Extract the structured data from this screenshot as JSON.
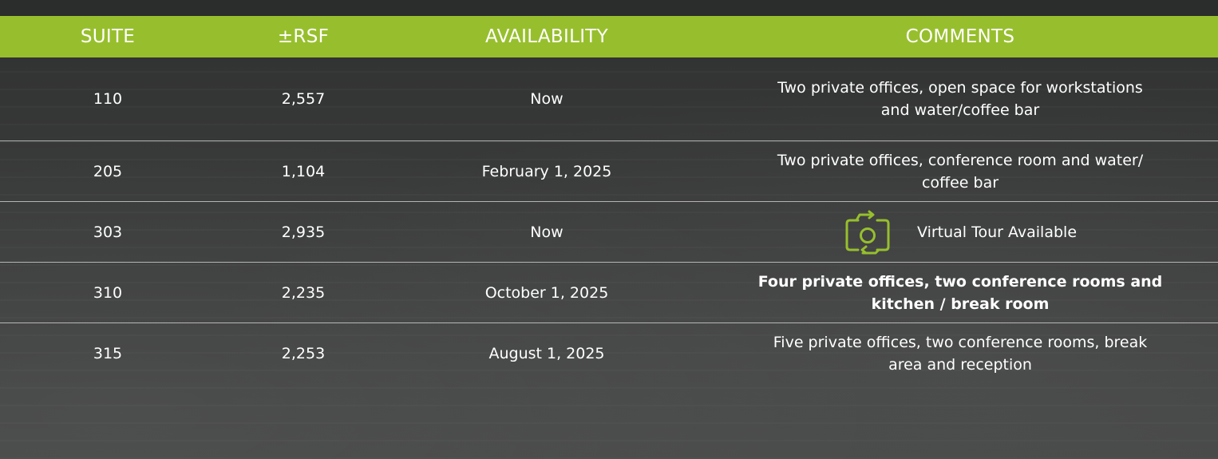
{
  "header": {
    "suite": "SUITE",
    "rsf": "±RSF",
    "availability": "AVAILABILITY",
    "comments": "COMMENTS"
  },
  "rows": [
    {
      "suite": "110",
      "rsf": "2,557",
      "availability": "Now",
      "comments": [
        "Two private offices, open space for workstations",
        "and water/coffee bar"
      ]
    },
    {
      "suite": "205",
      "rsf": "1,104",
      "availability": "February 1, 2025",
      "comments": [
        "Two private offices, conference room and water/",
        "coffee bar"
      ]
    },
    {
      "suite": "303",
      "rsf": "2,935",
      "availability": "Now",
      "comments": [
        "Virtual Tour Available"
      ],
      "icon": "virtual-tour-camera-icon"
    },
    {
      "suite": "310",
      "rsf": "2,235",
      "availability": "October 1, 2025",
      "comments": [
        "Four private offices, two conference rooms and",
        "kitchen / break room"
      ],
      "bold": true
    },
    {
      "suite": "315",
      "rsf": "2,253",
      "availability": "August 1, 2025",
      "comments": [
        "Five private offices, two conference rooms, break",
        "area and reception"
      ]
    }
  ],
  "colors": {
    "accent": "#97bf2d",
    "background": "#3a3b3b",
    "text": "#ffffff"
  }
}
